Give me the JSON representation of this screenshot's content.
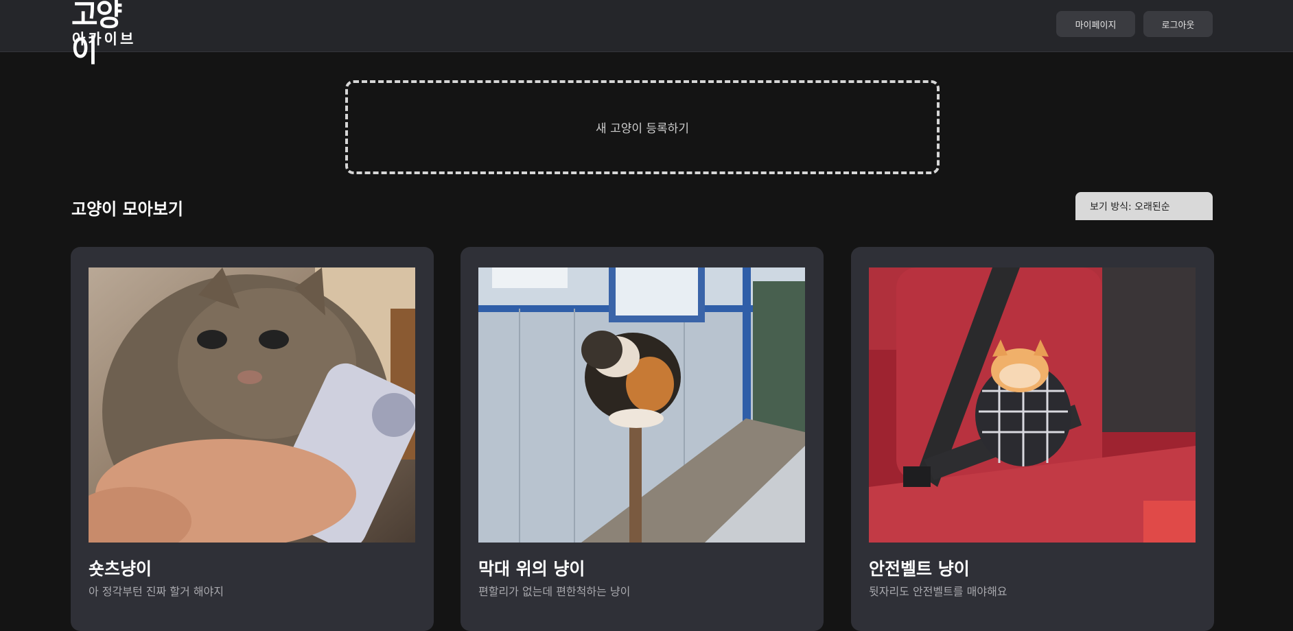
{
  "header": {
    "logo_top": "고양이",
    "logo_bottom": "아카이브",
    "mypage_label": "마이페이지",
    "logout_label": "로그아웃"
  },
  "register": {
    "label": "새 고양이 등록하기"
  },
  "gallery": {
    "title": "고양이 모아보기",
    "sort_label": "보기 방식: 오래된순"
  },
  "cards": [
    {
      "title": "숏츠냥이",
      "description": "아 정각부턴 진짜 할거 해야지",
      "image": "tabby-cat-with-phone-photo"
    },
    {
      "title": "막대 위의 냥이",
      "description": "편할리가 없는데 편한척하는 냥이",
      "image": "calico-cat-on-pole-photo"
    },
    {
      "title": "안전벨트 냥이",
      "description": "뒷자리도 안전벨트를 매야해요",
      "image": "kitten-in-car-seat-photo"
    }
  ],
  "colors": {
    "page_background": "#141414",
    "header_background": "#25262a",
    "card_background": "#2f3037",
    "button_background": "#3a3b40",
    "sort_background": "#d9d9d9"
  }
}
